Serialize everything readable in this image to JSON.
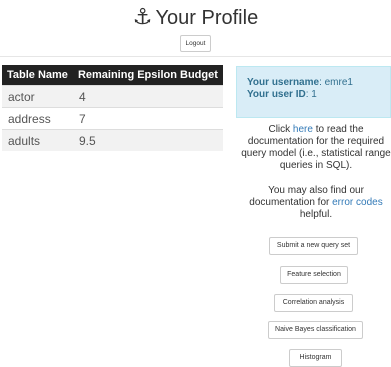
{
  "header": {
    "title": "Your Profile",
    "anchor_icon": "anchor-icon",
    "logout_label": "Logout"
  },
  "budget_table": {
    "headers": [
      "Table Name",
      "Remaining Epsilon Budget"
    ],
    "rows": [
      {
        "table": "actor",
        "budget": "4"
      },
      {
        "table": "address",
        "budget": "7"
      },
      {
        "table": "adults",
        "budget": "9.5"
      }
    ]
  },
  "user_info": {
    "username_label": "Your username",
    "username": "emre1",
    "userid_label": "Your user ID",
    "userid": "1"
  },
  "docs": {
    "p1_before": "Click ",
    "p1_link": "here",
    "p1_after": " to read the documentation for the required query model (i.e., statistical range queries in SQL).",
    "p2_before": "You may also find our documentation for ",
    "p2_link": "error codes",
    "p2_after": " helpful."
  },
  "actions": {
    "submit_query_set": "Submit a new query set",
    "feature_selection": "Feature selection",
    "correlation_analysis": "Correlation analysis",
    "naive_bayes": "Naive Bayes classification",
    "histogram": "Histogram"
  },
  "colors": {
    "table_header_bg": "#222222",
    "info_bg": "#d9edf7",
    "info_text": "#31708f",
    "link": "#337ab7"
  }
}
